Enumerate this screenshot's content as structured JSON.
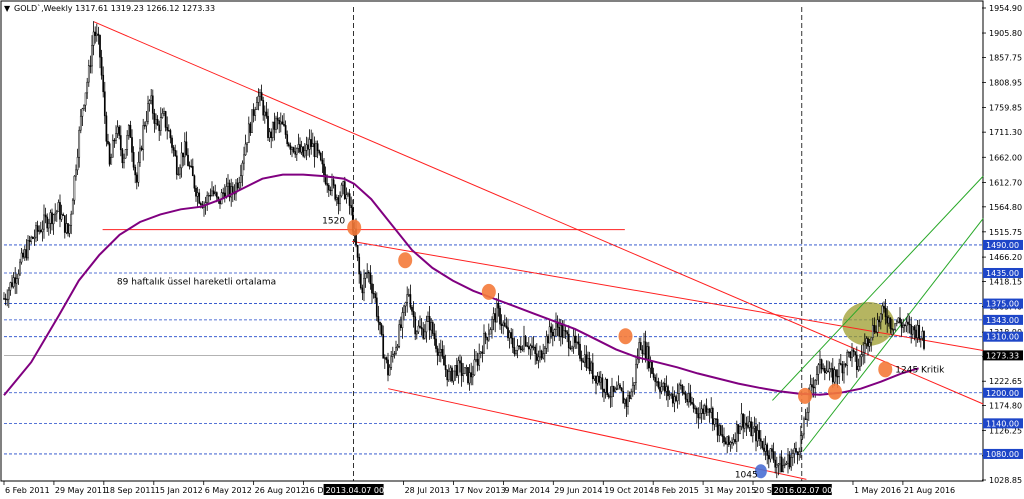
{
  "header": {
    "symbol_menu_glyph": "▼",
    "title": "GOLD`,Weekly  1317.61 1319.23 1266.12 1273.33"
  },
  "chart_data": {
    "type": "candlestick",
    "title": "GOLD`,Weekly",
    "ohlc_last": {
      "open": 1317.61,
      "high": 1319.23,
      "low": 1266.12,
      "close": 1273.33
    },
    "y_range": [
      1028.85,
      1954.9
    ],
    "y_ticks": [
      "1954.90",
      "1905.80",
      "1857.75",
      "1808.95",
      "1759.85",
      "1711.30",
      "1662.00",
      "1612.70",
      "1564.80",
      "1515.75",
      "1466.20",
      "1418.15",
      "1369.40",
      "1318.90",
      "1270.70",
      "1222.65",
      "1174.80",
      "1126.25",
      "1076.40",
      "1028.85"
    ],
    "x_ticks": [
      "6 Feb 2011",
      "29 May 2011",
      "18 Sep 2011",
      "15 Jan 2012",
      "6 May 2012",
      "26 Aug 2012",
      "16 Dec 2012",
      "28 Jul 2013",
      "17 Nov 2013",
      "9 Mar 2014",
      "29 Jun 2014",
      "19 Oct 2014",
      "8 Feb 2015",
      "31 May 2015",
      "20 Sep 2015",
      "1 May 2016",
      "21 Aug 2016"
    ],
    "x_tick_positions": [
      0.0,
      0.0734,
      0.1468,
      0.2203,
      0.2937,
      0.3671,
      0.4406,
      0.5876,
      0.661,
      0.7344,
      0.8078,
      0.8813,
      0.9547,
      1.0281,
      1.1015,
      1.2485,
      1.3219
    ],
    "vline_labels": [
      {
        "text": "2013.04.07 00:00",
        "pos": 0.5141
      },
      {
        "text": "2016.02.07 00:00",
        "pos": 1.1732
      }
    ],
    "horizontal_levels": [
      {
        "value": 1490.0,
        "label": "1490.00"
      },
      {
        "value": 1435.0,
        "label": "1435.00"
      },
      {
        "value": 1375.0,
        "label": "1375.00"
      },
      {
        "value": 1343.0,
        "label": "1343.00"
      },
      {
        "value": 1310.0,
        "label": "1310.00"
      },
      {
        "value": 1200.0,
        "label": "1200.00"
      },
      {
        "value": 1140.0,
        "label": "1140.00"
      },
      {
        "value": 1080.0,
        "label": "1080.00"
      }
    ],
    "current_price": {
      "value": 1273.33,
      "label": "1273.33"
    },
    "support_1520": {
      "value": 1520,
      "label": "1520"
    },
    "ema_label": "89 haftalık üssel hareketli ortalama",
    "kritik_label": "1245 Kritik",
    "low_label": "1045",
    "price_path": [
      [
        0.0,
        1385
      ],
      [
        0.02,
        1440
      ],
      [
        0.04,
        1500
      ],
      [
        0.06,
        1535
      ],
      [
        0.08,
        1560
      ],
      [
        0.095,
        1510
      ],
      [
        0.105,
        1640
      ],
      [
        0.115,
        1760
      ],
      [
        0.125,
        1830
      ],
      [
        0.132,
        1912
      ],
      [
        0.14,
        1880
      ],
      [
        0.146,
        1780
      ],
      [
        0.155,
        1640
      ],
      [
        0.165,
        1720
      ],
      [
        0.175,
        1660
      ],
      [
        0.185,
        1720
      ],
      [
        0.195,
        1610
      ],
      [
        0.205,
        1720
      ],
      [
        0.215,
        1775
      ],
      [
        0.225,
        1720
      ],
      [
        0.235,
        1740
      ],
      [
        0.245,
        1700
      ],
      [
        0.255,
        1640
      ],
      [
        0.265,
        1680
      ],
      [
        0.275,
        1630
      ],
      [
        0.285,
        1590
      ],
      [
        0.295,
        1570
      ],
      [
        0.305,
        1600
      ],
      [
        0.315,
        1570
      ],
      [
        0.325,
        1600
      ],
      [
        0.335,
        1590
      ],
      [
        0.345,
        1620
      ],
      [
        0.355,
        1690
      ],
      [
        0.365,
        1740
      ],
      [
        0.372,
        1785
      ],
      [
        0.38,
        1765
      ],
      [
        0.39,
        1700
      ],
      [
        0.4,
        1730
      ],
      [
        0.41,
        1720
      ],
      [
        0.42,
        1690
      ],
      [
        0.43,
        1680
      ],
      [
        0.44,
        1665
      ],
      [
        0.45,
        1690
      ],
      [
        0.46,
        1670
      ],
      [
        0.47,
        1630
      ],
      [
        0.48,
        1610
      ],
      [
        0.49,
        1585
      ],
      [
        0.5,
        1600
      ],
      [
        0.51,
        1560
      ],
      [
        0.518,
        1480
      ],
      [
        0.525,
        1400
      ],
      [
        0.535,
        1440
      ],
      [
        0.545,
        1390
      ],
      [
        0.555,
        1300
      ],
      [
        0.565,
        1240
      ],
      [
        0.575,
        1290
      ],
      [
        0.585,
        1335
      ],
      [
        0.595,
        1400
      ],
      [
        0.605,
        1330
      ],
      [
        0.615,
        1320
      ],
      [
        0.625,
        1340
      ],
      [
        0.635,
        1300
      ],
      [
        0.645,
        1260
      ],
      [
        0.655,
        1230
      ],
      [
        0.665,
        1250
      ],
      [
        0.675,
        1240
      ],
      [
        0.685,
        1230
      ],
      [
        0.695,
        1260
      ],
      [
        0.705,
        1300
      ],
      [
        0.715,
        1330
      ],
      [
        0.725,
        1360
      ],
      [
        0.735,
        1330
      ],
      [
        0.745,
        1300
      ],
      [
        0.755,
        1280
      ],
      [
        0.765,
        1310
      ],
      [
        0.775,
        1290
      ],
      [
        0.785,
        1260
      ],
      [
        0.795,
        1300
      ],
      [
        0.805,
        1320
      ],
      [
        0.815,
        1330
      ],
      [
        0.825,
        1310
      ],
      [
        0.835,
        1300
      ],
      [
        0.845,
        1280
      ],
      [
        0.855,
        1270
      ],
      [
        0.865,
        1240
      ],
      [
        0.875,
        1230
      ],
      [
        0.885,
        1210
      ],
      [
        0.895,
        1195
      ],
      [
        0.905,
        1200
      ],
      [
        0.915,
        1180
      ],
      [
        0.925,
        1210
      ],
      [
        0.935,
        1300
      ],
      [
        0.945,
        1280
      ],
      [
        0.955,
        1235
      ],
      [
        0.965,
        1215
      ],
      [
        0.975,
        1200
      ],
      [
        0.985,
        1190
      ],
      [
        0.995,
        1210
      ],
      [
        1.005,
        1185
      ],
      [
        1.015,
        1170
      ],
      [
        1.025,
        1160
      ],
      [
        1.035,
        1180
      ],
      [
        1.045,
        1145
      ],
      [
        1.055,
        1110
      ],
      [
        1.065,
        1095
      ],
      [
        1.075,
        1120
      ],
      [
        1.085,
        1150
      ],
      [
        1.095,
        1130
      ],
      [
        1.105,
        1120
      ],
      [
        1.115,
        1100
      ],
      [
        1.125,
        1085
      ],
      [
        1.135,
        1065
      ],
      [
        1.145,
        1055
      ],
      [
        1.155,
        1070
      ],
      [
        1.165,
        1085
      ],
      [
        1.175,
        1120
      ],
      [
        1.185,
        1200
      ],
      [
        1.195,
        1240
      ],
      [
        1.205,
        1260
      ],
      [
        1.215,
        1230
      ],
      [
        1.225,
        1240
      ],
      [
        1.235,
        1260
      ],
      [
        1.245,
        1280
      ],
      [
        1.255,
        1250
      ],
      [
        1.265,
        1290
      ],
      [
        1.275,
        1320
      ],
      [
        1.285,
        1340
      ],
      [
        1.295,
        1360
      ],
      [
        1.305,
        1335
      ],
      [
        1.315,
        1340
      ],
      [
        1.325,
        1330
      ],
      [
        1.335,
        1320
      ],
      [
        1.345,
        1325
      ],
      [
        1.35,
        1310
      ],
      [
        1.355,
        1273
      ]
    ],
    "ema_path": [
      [
        0.0,
        1195
      ],
      [
        0.04,
        1260
      ],
      [
        0.08,
        1350
      ],
      [
        0.11,
        1420
      ],
      [
        0.14,
        1470
      ],
      [
        0.17,
        1510
      ],
      [
        0.2,
        1535
      ],
      [
        0.23,
        1550
      ],
      [
        0.26,
        1560
      ],
      [
        0.29,
        1565
      ],
      [
        0.32,
        1580
      ],
      [
        0.35,
        1600
      ],
      [
        0.38,
        1620
      ],
      [
        0.41,
        1628
      ],
      [
        0.44,
        1628
      ],
      [
        0.47,
        1625
      ],
      [
        0.5,
        1620
      ],
      [
        0.515,
        1610
      ],
      [
        0.54,
        1580
      ],
      [
        0.57,
        1530
      ],
      [
        0.6,
        1480
      ],
      [
        0.63,
        1445
      ],
      [
        0.66,
        1420
      ],
      [
        0.69,
        1400
      ],
      [
        0.72,
        1385
      ],
      [
        0.75,
        1370
      ],
      [
        0.78,
        1355
      ],
      [
        0.81,
        1340
      ],
      [
        0.84,
        1325
      ],
      [
        0.87,
        1305
      ],
      [
        0.9,
        1285
      ],
      [
        0.93,
        1270
      ],
      [
        0.96,
        1260
      ],
      [
        0.99,
        1250
      ],
      [
        1.02,
        1238
      ],
      [
        1.05,
        1228
      ],
      [
        1.08,
        1218
      ],
      [
        1.11,
        1210
      ],
      [
        1.14,
        1203
      ],
      [
        1.17,
        1198
      ],
      [
        1.2,
        1196
      ],
      [
        1.23,
        1200
      ],
      [
        1.26,
        1208
      ],
      [
        1.29,
        1222
      ],
      [
        1.32,
        1238
      ],
      [
        1.345,
        1248
      ]
    ],
    "red_trend_lines": [
      {
        "x1": 0.132,
        "y1": 1928,
        "x2": 1.44,
        "y2": 1178
      },
      {
        "x1": 0.512,
        "y1": 1497,
        "x2": 1.44,
        "y2": 1283
      },
      {
        "x1": 0.565,
        "y1": 1208,
        "x2": 1.18,
        "y2": 1030
      }
    ],
    "green_channel_lines": [
      {
        "x1": 1.13,
        "y1": 1185,
        "x2": 1.44,
        "y2": 1625
      },
      {
        "x1": 1.175,
        "y1": 1085,
        "x2": 1.44,
        "y2": 1542
      }
    ],
    "support_line": {
      "x1": 0.145,
      "x2": 0.913,
      "y": 1520
    },
    "orange_markers": [
      {
        "x": 0.515,
        "y": 1524
      },
      {
        "x": 0.59,
        "y": 1460
      },
      {
        "x": 0.713,
        "y": 1398
      },
      {
        "x": 0.914,
        "y": 1311
      },
      {
        "x": 1.178,
        "y": 1194
      },
      {
        "x": 1.222,
        "y": 1202
      },
      {
        "x": 1.296,
        "y": 1246
      }
    ],
    "blue_marker": {
      "x": 1.113,
      "y": 1046
    },
    "highlight_zone": {
      "x": 1.271,
      "y": 1335
    },
    "colors": {
      "background": "#ffffff",
      "candle": "#000000",
      "ema": "#800080",
      "trend_red": "#ff2020",
      "channel_green": "#28a828",
      "level_blue": "#1e46c8",
      "marker_orange": "#f47a3a",
      "marker_blue": "#4a6fd4",
      "zone_olive": "#9c9c2c",
      "label_bg_blue": "#1e46c8",
      "label_bg_black": "#000000"
    }
  }
}
